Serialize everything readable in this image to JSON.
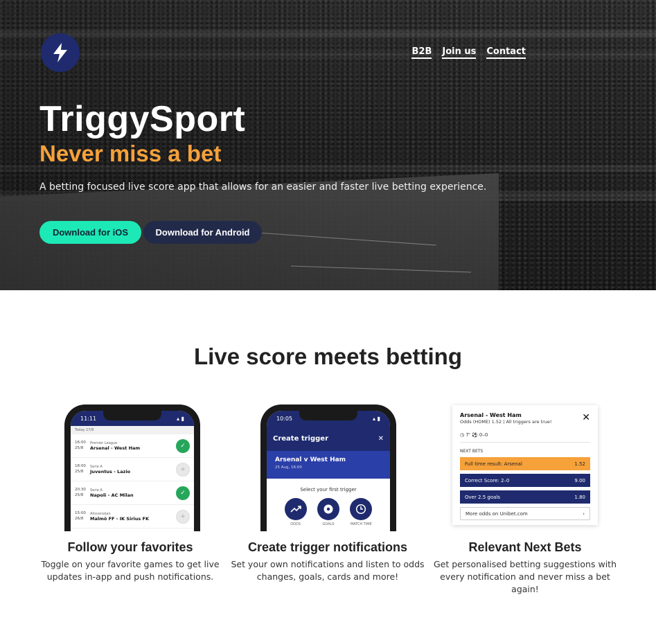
{
  "brand": {
    "name": "TriggySport",
    "tagline": "Never miss a bet",
    "description": "A betting focused live score app that allows for an easier and faster live betting experience.",
    "accent_color": "#f6a13a",
    "logo_icon": "lightning-bolt-icon"
  },
  "nav": {
    "items": [
      "B2B",
      "Join us",
      "Contact"
    ]
  },
  "cta": {
    "ios_label": "Download for iOS",
    "android_label": "Download for Android"
  },
  "features": {
    "title": "Live score meets betting",
    "items": [
      {
        "title": "Follow your favorites",
        "desc_line1": "Toggle on your favorite games to get live",
        "desc_line2": "updates in-app and push notifications."
      },
      {
        "title": "Create trigger notifications",
        "desc_line1": "Set your own notifications and listen to odds",
        "desc_line2": "changes, goals, cards and more!"
      },
      {
        "title": "Relevant Next Bets",
        "desc_line1": "Get personalised betting suggestions with",
        "desc_line2": "every notification and never miss a bet again!"
      }
    ]
  },
  "phone1": {
    "time": "11:11",
    "date": "Today 27/8",
    "matches": [
      {
        "time": "16:00",
        "date": "25/8",
        "league": "Premier League",
        "teams": "Arsenal - West Ham",
        "on": true
      },
      {
        "time": "18:00",
        "date": "25/8",
        "league": "Serie A",
        "teams": "Juventus - Lazio",
        "on": false
      },
      {
        "time": "20:30",
        "date": "25/8",
        "league": "Serie A",
        "teams": "Napoli - AC Milan",
        "on": true
      },
      {
        "time": "15:00",
        "date": "26/8",
        "league": "Allsvenskan",
        "teams": "Malmö FF - IK Sirius FK",
        "on": false
      }
    ]
  },
  "phone2": {
    "time": "10:05",
    "header": "Create trigger",
    "match": "Arsenal v West Ham",
    "match_date": "25 Aug, 16:00",
    "prompt": "Select your first trigger",
    "triggers": [
      "ODDS",
      "GOALS",
      "MATCH TIME"
    ]
  },
  "bet_card": {
    "title": "Arsenal - West Ham",
    "subtitle": "Odds (HOME) 1.52 | All triggers are true!",
    "clock": "7'",
    "score": "0–0",
    "section": "NEXT BETS",
    "bets": [
      {
        "label": "Full time result: Arsenal",
        "odds": "1.52"
      },
      {
        "label": "Correct Score: 2–0",
        "odds": "9.00"
      },
      {
        "label": "Over 2.5 goals",
        "odds": "1.80"
      }
    ],
    "more": "More odds on Unibet.com"
  }
}
